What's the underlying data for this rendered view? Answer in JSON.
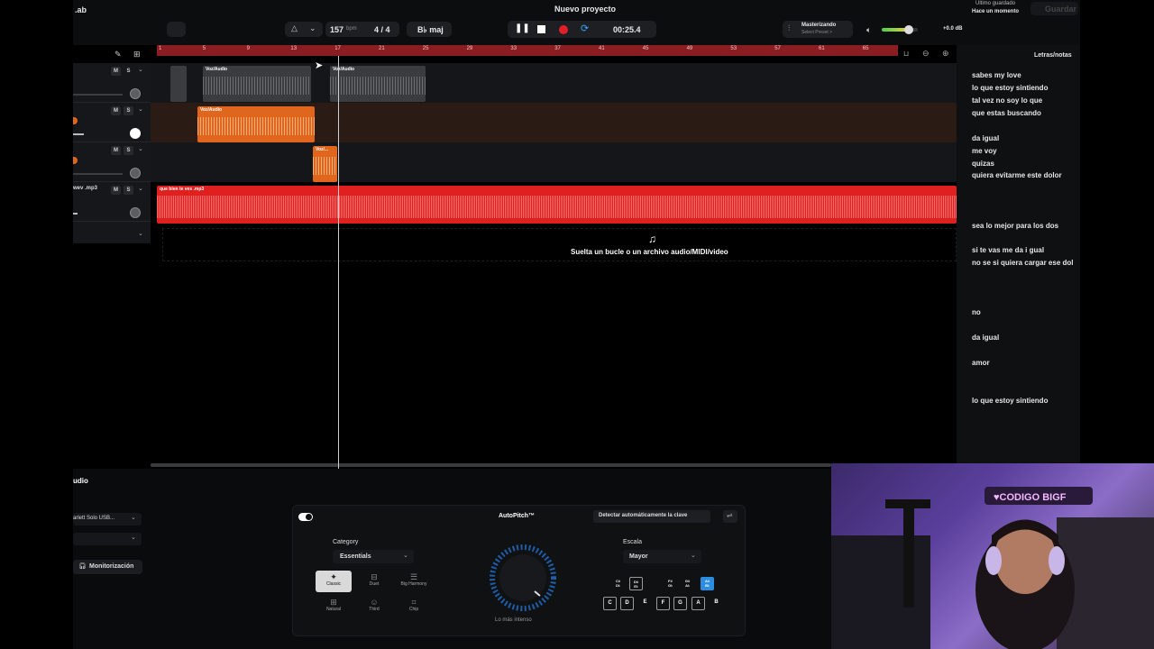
{
  "app": {
    "logo_fragment": ".ab",
    "project_title": "Nuevo proyecto",
    "saved_status": "Último guardado",
    "saved_time": "Hace un momento",
    "save_label": "Guardar"
  },
  "transport": {
    "bpm": "157",
    "bpm_unit": "bpm",
    "time_signature": "4 / 4",
    "key": "B♭ maj",
    "time": "00:25.4",
    "mastering_label": "Masterizando",
    "mastering_preset": "Select Preset >",
    "volume_readout": "+0.0 dB",
    "volume_level": 0.75
  },
  "ruler": {
    "bars": [
      "1",
      "5",
      "9",
      "13",
      "17",
      "21",
      "25",
      "29",
      "33",
      "37",
      "41",
      "45",
      "49",
      "53",
      "57",
      "61",
      "65"
    ]
  },
  "tracks": [
    {
      "name": "",
      "clips": [
        {
          "label": "",
          "color": "#3a3c40"
        },
        {
          "label": "Voz/Audio",
          "color": "#3a3c40"
        },
        {
          "label": "Voz/Audio",
          "color": "#3a3c40"
        }
      ]
    },
    {
      "name": "",
      "clips": [
        {
          "label": "Voz/Audio",
          "color": "#e0651d"
        }
      ]
    },
    {
      "name": "",
      "clips": [
        {
          "label": "Voz/...",
          "color": "#e0651d"
        }
      ]
    },
    {
      "name": "wev .mp3",
      "clips": [
        {
          "label": "que bien te ves .mp3",
          "color": "#e01f1f"
        }
      ]
    }
  ],
  "track_buttons": {
    "mute": "M",
    "solo": "S"
  },
  "drop_zone": {
    "text": "Suelta un bucle o un archivo audio/MIDI/video"
  },
  "lyrics_panel": {
    "title": "Letras/notas",
    "lines": [
      "sabes my love",
      "lo que estoy  sintiendo",
      "tal vez no soy lo que",
      " que estas buscando",
      "da igual",
      "me voy",
      "quizas",
      "quiera evitarme este dolor",
      "sea lo mejor para los dos",
      "si te vas me da i gual",
      "  no se si quiera cargar ese dol",
      "no",
      "da igual",
      "amor",
      "lo que estoy sintiendo"
    ]
  },
  "bottom_panel": {
    "section_title": "udio",
    "device": "arlett Solo USB...",
    "monitor_label": "Monitorización"
  },
  "autopitch": {
    "title": "AutoPitch™",
    "detect_key": "Detectar automáticamente la clave",
    "category_label": "Category",
    "category_value": "Essentials",
    "categories": [
      "Classic",
      "Duet",
      "Big Harmony",
      "Natural",
      "Third",
      "Chip"
    ],
    "knob_label": "Lo más intenso",
    "scale_label": "Escala",
    "scale_value": "Mayor",
    "black_keys": [
      "C#\nD♭",
      "D#\nE♭",
      "F#\nG♭",
      "G#\nA♭",
      "A#\nB♭"
    ],
    "white_keys": [
      "C",
      "D",
      "E",
      "F",
      "G",
      "A",
      "B"
    ]
  }
}
